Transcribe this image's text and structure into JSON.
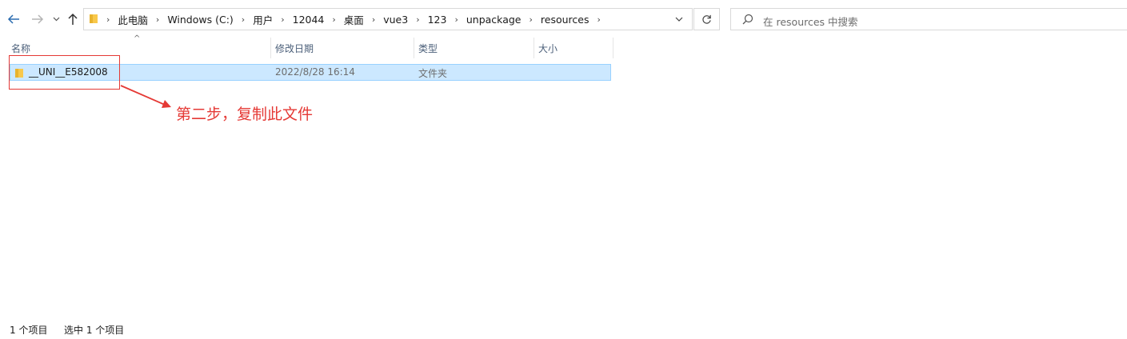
{
  "toolbar": {
    "back_icon": "arrow-left-icon",
    "forward_icon": "arrow-right-icon",
    "recent_icon": "chevron-down-icon",
    "up_icon": "arrow-up-icon"
  },
  "address": {
    "crumbs": [
      "此电脑",
      "Windows (C:)",
      "用户",
      "12044",
      "桌面",
      "vue3",
      "123",
      "unpackage",
      "resources"
    ]
  },
  "search": {
    "placeholder": "在 resources 中搜索"
  },
  "columns": {
    "name": "名称",
    "modified": "修改日期",
    "type": "类型",
    "size": "大小"
  },
  "files": [
    {
      "name": "__UNI__E582008",
      "modified": "2022/8/28 16:14",
      "type": "文件夹",
      "size": ""
    }
  ],
  "annotation": {
    "text": "第二步，复制此文件",
    "color": "#e53935"
  },
  "status": {
    "count": "1 个项目",
    "selected": "选中 1 个项目"
  },
  "colors": {
    "selection_bg": "#cce8ff",
    "selection_border": "#99d1ff",
    "folder": "#f8c84b"
  }
}
